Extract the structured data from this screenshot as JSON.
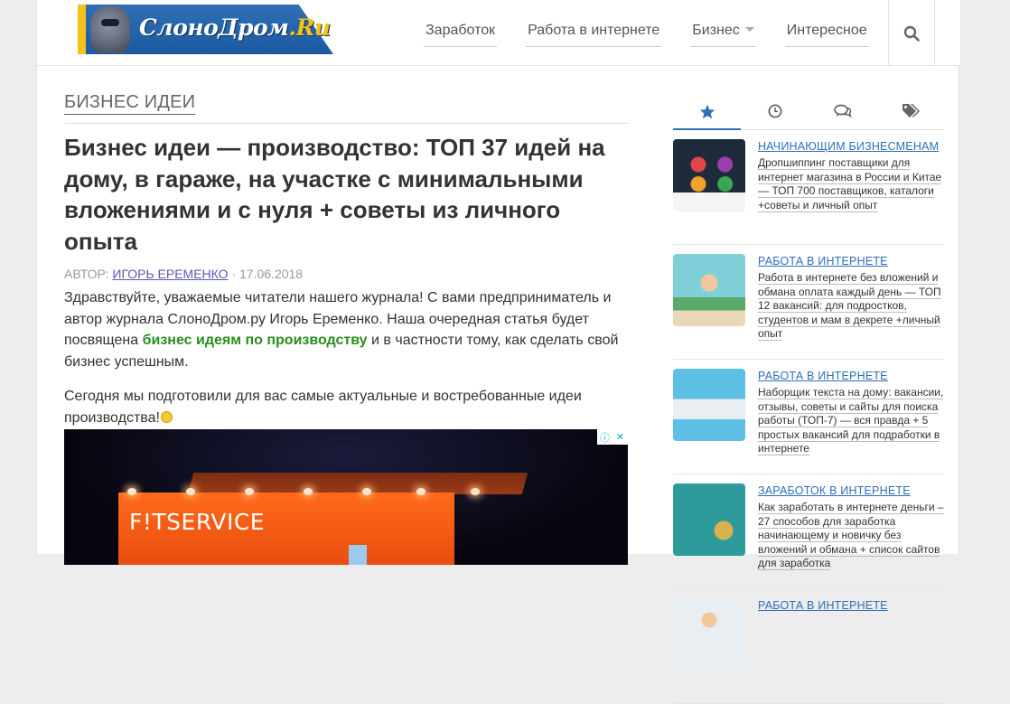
{
  "brand": {
    "logo_text": "СлоноДром",
    "logo_suffix": ".Ru",
    "colors": {
      "accent": "#2d6fb8",
      "logo_yellow": "#f6c21a",
      "highlight_green": "#2a8c1f"
    }
  },
  "nav": {
    "items": [
      {
        "label": "Заработок"
      },
      {
        "label": "Работа в интернете"
      },
      {
        "label": "Бизнес",
        "has_dropdown": true
      },
      {
        "label": "Интересное"
      }
    ],
    "search_icon": "search-icon"
  },
  "main": {
    "section_title": "БИЗНЕС ИДЕИ",
    "article_title": "Бизнес идеи — производство: ТОП 37 идей на дому, в гараже, на участке с минимальными вложениями и с нуля + советы из личного опыта",
    "meta": {
      "author_prefix": "АВТОР:",
      "author": "ИГОРЬ ЕРЕМЕНКО",
      "separator": "·",
      "date": "17.06.2018"
    },
    "p1_a": "Здравствуйте, уважаемые читатели нашего журнала! С вами предприниматель и автор журнала СлоноДром.ру Игорь Еременко. Наша очередная статья будет посвящена ",
    "p1_highlight": "бизнес идеям по производству",
    "p1_b": " и в частности тому, как сделать свой бизнес успешным.",
    "p2": "Сегодня мы подготовили для вас самые актуальные и востребованные идеи производства!",
    "ad": {
      "sign_text": "F!TSERVICE",
      "marker_icons": [
        "info-icon",
        "close-icon"
      ]
    }
  },
  "sidebar": {
    "tabs": [
      {
        "icon": "star-icon",
        "active": true
      },
      {
        "icon": "clock-icon",
        "active": false
      },
      {
        "icon": "comments-icon",
        "active": false
      },
      {
        "icon": "tags-icon",
        "active": false
      }
    ],
    "posts": [
      {
        "category": "НАЧИНАЮЩИМ БИЗНЕСМЕНАМ",
        "title": "Дропшиппинг поставщики для интернет магазина в России и Китае — ТОП 700 поставщиков, каталоги +советы и личный опыт",
        "thumb_color": "#1f2a3a"
      },
      {
        "category": "РАБОТА В ИНТЕРНЕТЕ",
        "title": "Работа в интернете без вложений и обмана оплата каждый день — ТОП 12 вакансий: для подростков, студентов и мам в декрете +личный опыт",
        "thumb_color": "#7fd0d9"
      },
      {
        "category": "РАБОТА В ИНТЕРНЕТЕ",
        "title": "Наборщик текста на дому: вакансии, отзывы, советы и сайты для поиска работы (ТОП-7) — вся правда + 5 простых вакансий для подработки в интернете",
        "thumb_color": "#5ec0e6"
      },
      {
        "category": "ЗАРАБОТОК В ИНТЕРНЕТЕ",
        "title": "Как заработать в интернете деньги – 27 способов для заработка начинающему и новичку без вложений и обмана + список сайтов для заработка",
        "thumb_color": "#2e9a9c"
      },
      {
        "category": "РАБОТА В ИНТЕРНЕТЕ",
        "title": "",
        "thumb_color": "#e9eef2"
      }
    ]
  }
}
